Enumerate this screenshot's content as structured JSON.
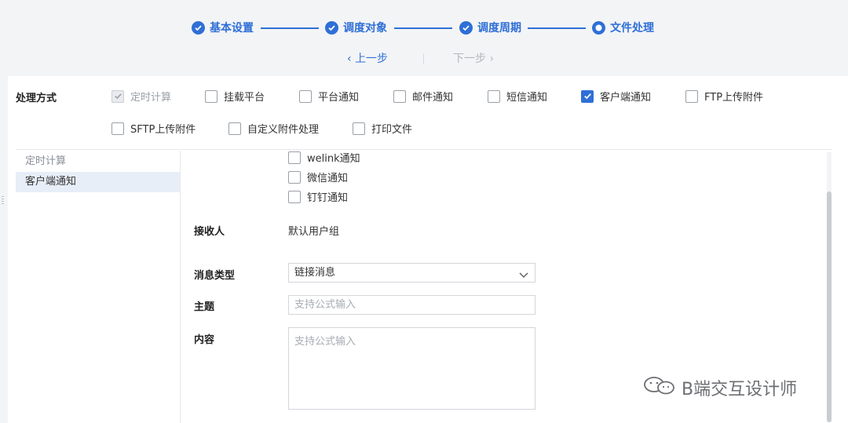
{
  "stepper": {
    "steps": [
      {
        "label": "基本设置",
        "state": "done"
      },
      {
        "label": "调度对象",
        "state": "done"
      },
      {
        "label": "调度周期",
        "state": "done"
      },
      {
        "label": "文件处理",
        "state": "current"
      }
    ],
    "prev_label": "上一步",
    "next_label": "下一步"
  },
  "processing": {
    "title": "处理方式",
    "options": [
      {
        "label": "定时计算",
        "checked": true,
        "disabled": true
      },
      {
        "label": "挂载平台",
        "checked": false
      },
      {
        "label": "平台通知",
        "checked": false
      },
      {
        "label": "邮件通知",
        "checked": false
      },
      {
        "label": "短信通知",
        "checked": false
      },
      {
        "label": "客户端通知",
        "checked": true
      },
      {
        "label": "FTP上传附件",
        "checked": false
      },
      {
        "label": "SFTP上传附件",
        "checked": false
      },
      {
        "label": "自定义附件处理",
        "checked": false
      },
      {
        "label": "打印文件",
        "checked": false
      }
    ]
  },
  "sidebar": {
    "items": [
      {
        "label": "定时计算",
        "active": false
      },
      {
        "label": "客户端通知",
        "active": true
      }
    ]
  },
  "form": {
    "notify_options": [
      {
        "label": "welink通知",
        "checked": false
      },
      {
        "label": "微信通知",
        "checked": false
      },
      {
        "label": "钉钉通知",
        "checked": false
      }
    ],
    "receiver_label": "接收人",
    "receiver_value": "默认用户组",
    "msg_type_label": "消息类型",
    "msg_type_value": "链接消息",
    "subject_label": "主题",
    "subject_placeholder": "支持公式输入",
    "content_label": "内容",
    "content_placeholder": "支持公式输入"
  },
  "watermark": {
    "text": "B端交互设计师"
  },
  "colors": {
    "accent": "#2f6fd6",
    "muted": "#9aa0a8",
    "border": "#d3d6db"
  }
}
